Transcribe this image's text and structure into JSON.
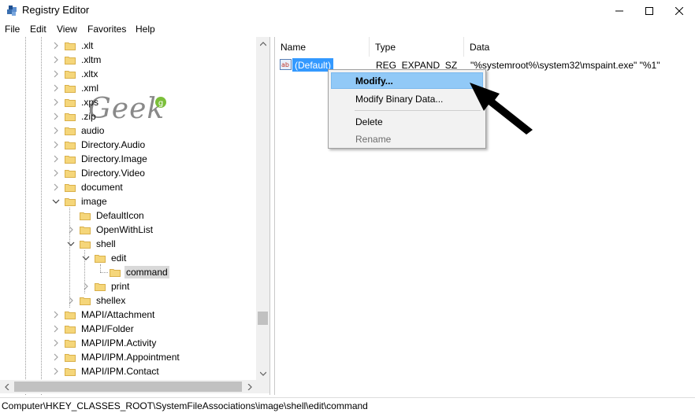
{
  "window": {
    "title": "Registry Editor",
    "app_icon": "registry-editor-icon",
    "buttons": [
      "minimize-icon",
      "maximize-icon",
      "close-icon"
    ]
  },
  "menu": {
    "items": [
      "File",
      "Edit",
      "View",
      "Favorites",
      "Help"
    ]
  },
  "tree": {
    "items": [
      {
        "label": ".xlt",
        "level": 0,
        "expander": "collapsed"
      },
      {
        "label": ".xltm",
        "level": 0,
        "expander": "collapsed"
      },
      {
        "label": ".xltx",
        "level": 0,
        "expander": "collapsed"
      },
      {
        "label": ".xml",
        "level": 0,
        "expander": "collapsed"
      },
      {
        "label": ".xps",
        "level": 0,
        "expander": "collapsed"
      },
      {
        "label": ".zip",
        "level": 0,
        "expander": "collapsed"
      },
      {
        "label": "audio",
        "level": 0,
        "expander": "collapsed"
      },
      {
        "label": "Directory.Audio",
        "level": 0,
        "expander": "collapsed"
      },
      {
        "label": "Directory.Image",
        "level": 0,
        "expander": "collapsed"
      },
      {
        "label": "Directory.Video",
        "level": 0,
        "expander": "collapsed"
      },
      {
        "label": "document",
        "level": 0,
        "expander": "collapsed"
      },
      {
        "label": "image",
        "level": 0,
        "expander": "expanded"
      },
      {
        "label": "DefaultIcon",
        "level": 1,
        "expander": "none"
      },
      {
        "label": "OpenWithList",
        "level": 1,
        "expander": "collapsed"
      },
      {
        "label": "shell",
        "level": 1,
        "expander": "expanded"
      },
      {
        "label": "edit",
        "level": 2,
        "expander": "expanded"
      },
      {
        "label": "command",
        "level": 3,
        "expander": "none",
        "selected": true
      },
      {
        "label": "print",
        "level": 2,
        "expander": "collapsed"
      },
      {
        "label": "shellex",
        "level": 1,
        "expander": "collapsed"
      },
      {
        "label": "MAPI/Attachment",
        "level": 0,
        "expander": "collapsed"
      },
      {
        "label": "MAPI/Folder",
        "level": 0,
        "expander": "collapsed"
      },
      {
        "label": "MAPI/IPM.Activity",
        "level": 0,
        "expander": "collapsed"
      },
      {
        "label": "MAPI/IPM.Appointment",
        "level": 0,
        "expander": "collapsed"
      },
      {
        "label": "MAPI/IPM.Contact",
        "level": 0,
        "expander": "collapsed"
      }
    ]
  },
  "values_list": {
    "headers": [
      "Name",
      "Type",
      "Data"
    ],
    "rows": [
      {
        "name": "(Default)",
        "type": "REG_EXPAND_SZ",
        "data": "\"%systemroot%\\system32\\mspaint.exe\" \"%1\"",
        "icon": "string-value-icon"
      }
    ]
  },
  "context_menu": {
    "items": [
      "Modify...",
      "Modify Binary Data...",
      "Delete",
      "Rename"
    ],
    "highlighted": "Modify...",
    "disabled": [
      "Rename"
    ]
  },
  "watermark": {
    "text": "Geek"
  },
  "statusbar": {
    "path": "Computer\\HKEY_CLASSES_ROOT\\SystemFileAssociations\\image\\shell\\edit\\command"
  },
  "colors": {
    "selection": "#3399ff",
    "menu_highlight": "#91c9f7",
    "folder": "#f5d67a"
  }
}
